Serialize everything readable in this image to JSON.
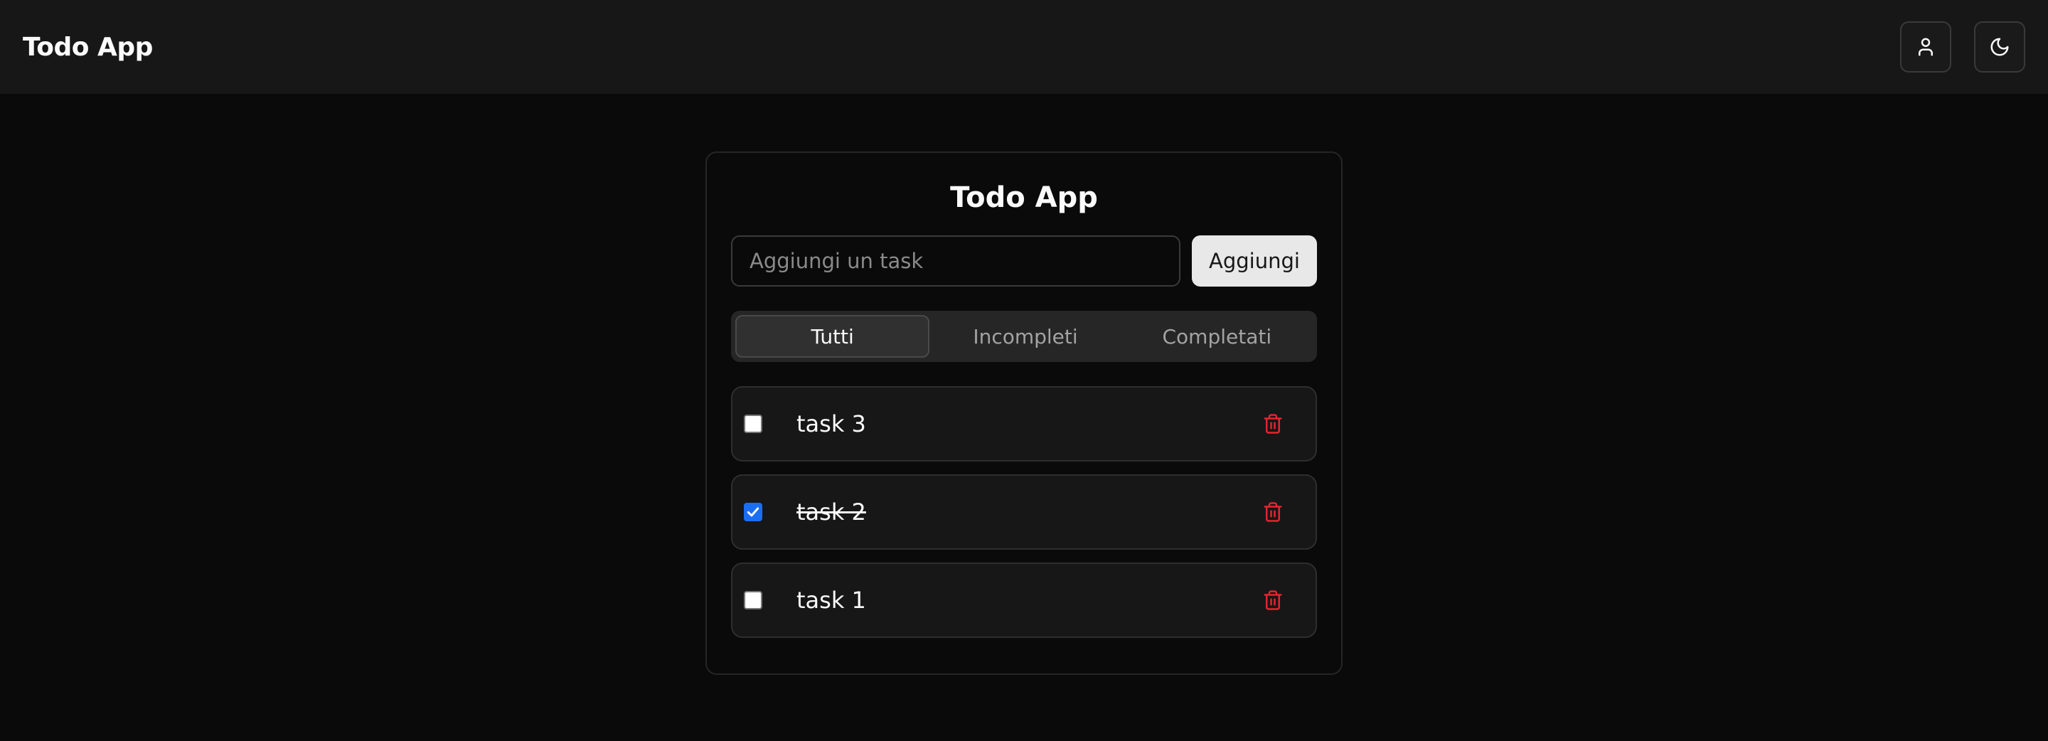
{
  "header": {
    "brand": "Todo App",
    "user_icon": "user-icon",
    "theme_icon": "moon-icon"
  },
  "card": {
    "title": "Todo App",
    "input": {
      "placeholder": "Aggiungi un task",
      "value": ""
    },
    "add_label": "Aggiungi",
    "tabs": [
      {
        "label": "Tutti",
        "active": true
      },
      {
        "label": "Incompleti",
        "active": false
      },
      {
        "label": "Completati",
        "active": false
      }
    ],
    "tasks": [
      {
        "text": "task 3",
        "completed": false
      },
      {
        "text": "task 2",
        "completed": true
      },
      {
        "text": "task 1",
        "completed": false
      }
    ],
    "delete_icon": "trash-icon"
  },
  "colors": {
    "background": "#0a0a0a",
    "header": "#171717",
    "delete": "#e5242e",
    "checkbox_checked": "#1a6ef2",
    "add_button": "#e8e8e8"
  }
}
